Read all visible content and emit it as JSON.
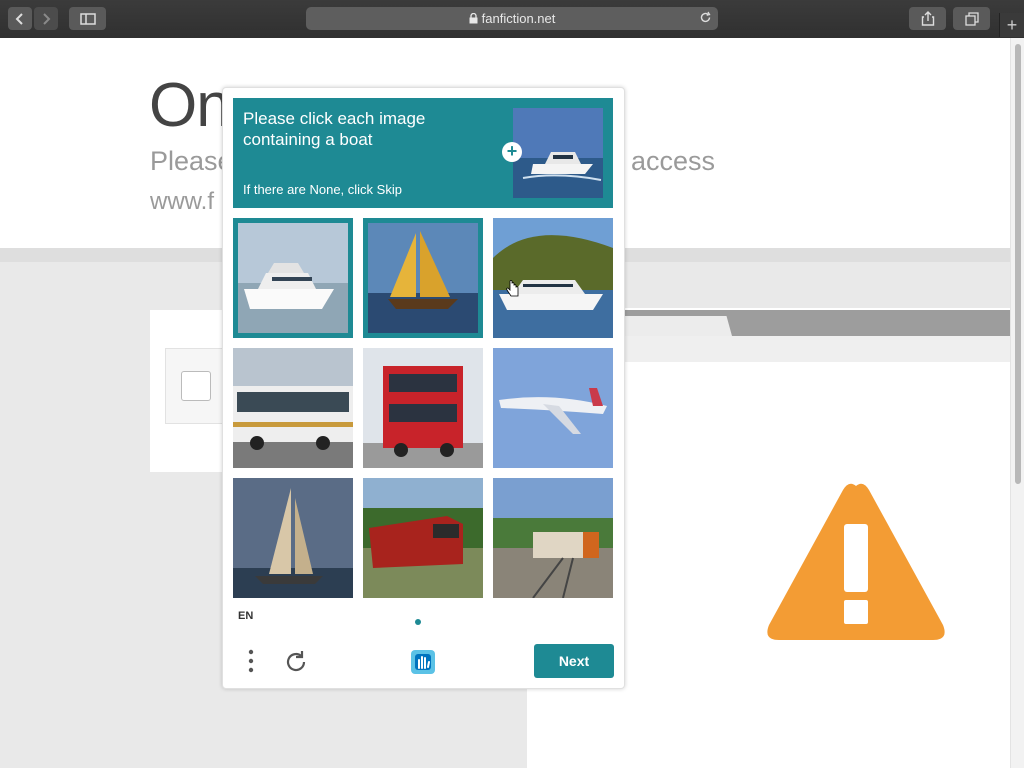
{
  "browser": {
    "url": "fanfiction.net",
    "new_tab": "+"
  },
  "page": {
    "title_partial": "On",
    "subtitle_left": "Please",
    "subtitle_right": "access",
    "url_partial": "www.f"
  },
  "captcha": {
    "prompt": "Please click each image containing a boat",
    "hint": "If there are None, click Skip",
    "example_plus": "+",
    "language": "EN",
    "next_label": "Next",
    "accent_color": "#1e8a94",
    "tiles": [
      {
        "subject": "motor yacht",
        "selected": true
      },
      {
        "subject": "sailboat with yellow sails",
        "selected": true
      },
      {
        "subject": "yacht near hills",
        "selected": false
      },
      {
        "subject": "city bus",
        "selected": false
      },
      {
        "subject": "red double-decker bus",
        "selected": false
      },
      {
        "subject": "airplane",
        "selected": false
      },
      {
        "subject": "sailboat",
        "selected": false
      },
      {
        "subject": "red locomotive",
        "selected": false
      },
      {
        "subject": "passenger train",
        "selected": false
      }
    ]
  },
  "warning": {
    "color": "#f39c34",
    "icon": "warning-icon"
  }
}
